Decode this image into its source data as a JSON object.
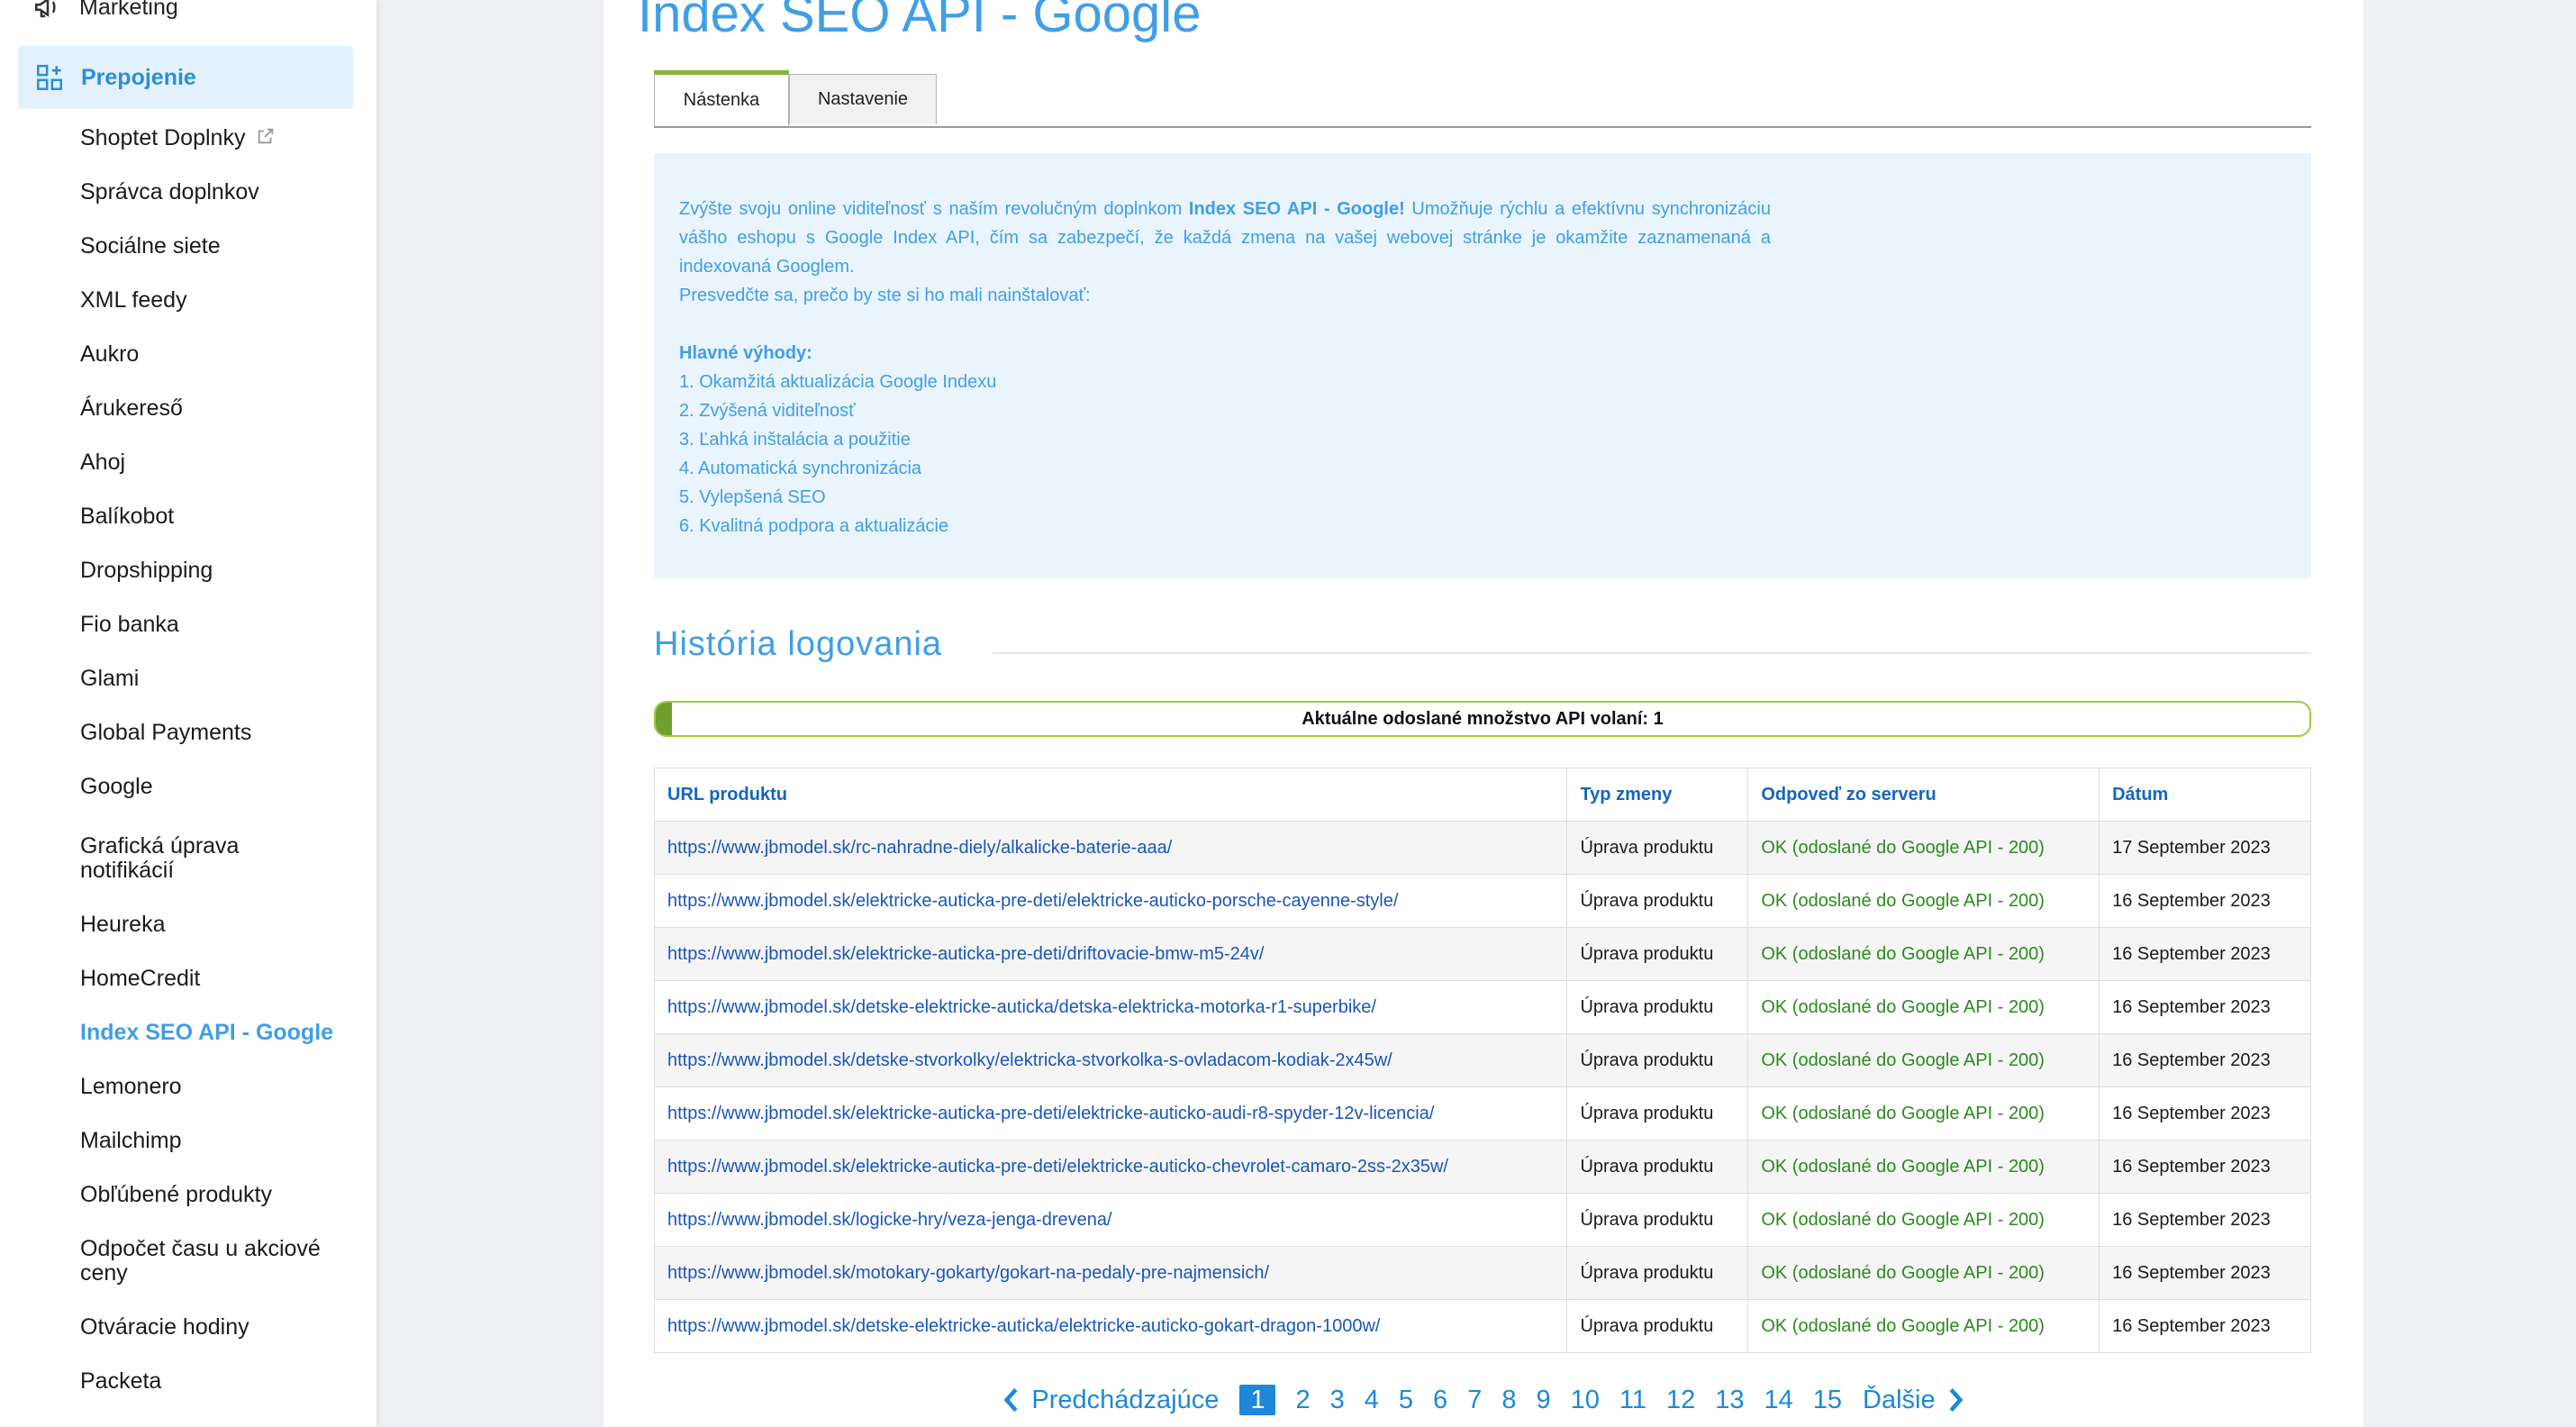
{
  "sidebar": {
    "top_item": "Marketing",
    "active_section": "Prepojenie",
    "items": [
      {
        "label": "Shoptet Doplnky",
        "external": true
      },
      {
        "label": "Správca doplnkov"
      },
      {
        "label": "Sociálne siete"
      },
      {
        "label": "XML feedy"
      },
      {
        "label": "Aukro"
      },
      {
        "label": "Árukereső"
      },
      {
        "label": "Ahoj"
      },
      {
        "label": "Balíkobot"
      },
      {
        "label": "Dropshipping"
      },
      {
        "label": "Fio banka"
      },
      {
        "label": "Glami"
      },
      {
        "label": "Global Payments"
      },
      {
        "label": "Google"
      },
      {
        "label": "Grafická úprava notifikácií"
      },
      {
        "label": "Heureka"
      },
      {
        "label": "HomeCredit"
      },
      {
        "label": "Index SEO API - Google",
        "current": true
      },
      {
        "label": "Lemonero"
      },
      {
        "label": "Mailchimp"
      },
      {
        "label": "Obľúbené produkty"
      },
      {
        "label": "Odpočet času u akciové ceny"
      },
      {
        "label": "Otváracie hodiny"
      },
      {
        "label": "Packeta"
      }
    ]
  },
  "main": {
    "title": "Index SEO API - Google",
    "tabs": [
      {
        "label": "Nástenka",
        "active": true
      },
      {
        "label": "Nastavenie",
        "active": false
      }
    ],
    "intro": {
      "p1_before": "Zvýšte svoju online viditeľnosť s naším revolučným doplnkom ",
      "p1_bold": "Index SEO API - Google!",
      "p1_after": " Umožňuje rýchlu a efektívnu synchronizáciu vášho eshopu s Google Index API, čím sa zabezpečí, že každá zmena na vašej webovej stránke je okamžite zaznamenaná a indexovaná Googlem.",
      "p2": "Presvedčte sa, prečo by ste si ho mali nainštalovať:",
      "benefits_title": "Hlavné výhody:",
      "benefits": [
        "1. Okamžitá aktualizácia Google Indexu",
        "2. Zvýšená viditeľnosť",
        "3. Ľahká inštalácia a použitie",
        "4. Automatická synchronizácia",
        "5. Vylepšená SEO",
        "6. Kvalitná podpora a aktualizácie"
      ]
    },
    "log_title": "História logovania",
    "api_counter": {
      "label": "Aktuálne odoslané množstvo API volaní: 1",
      "fill_percent": 1
    },
    "table": {
      "headers": [
        "URL produktu",
        "Typ zmeny",
        "Odpoveď zo serveru",
        "Dátum"
      ],
      "rows": [
        {
          "url": "https://www.jbmodel.sk/rc-nahradne-diely/alkalicke-baterie-aaa/",
          "type": "Úprava produktu",
          "response": "OK (odoslané do Google API - 200)",
          "date": "17 September 2023"
        },
        {
          "url": "https://www.jbmodel.sk/elektricke-auticka-pre-deti/elektricke-auticko-porsche-cayenne-style/",
          "type": "Úprava produktu",
          "response": "OK (odoslané do Google API - 200)",
          "date": "16 September 2023"
        },
        {
          "url": "https://www.jbmodel.sk/elektricke-auticka-pre-deti/driftovacie-bmw-m5-24v/",
          "type": "Úprava produktu",
          "response": "OK (odoslané do Google API - 200)",
          "date": "16 September 2023"
        },
        {
          "url": "https://www.jbmodel.sk/detske-elektricke-auticka/detska-elektricka-motorka-r1-superbike/",
          "type": "Úprava produktu",
          "response": "OK (odoslané do Google API - 200)",
          "date": "16 September 2023"
        },
        {
          "url": "https://www.jbmodel.sk/detske-stvorkolky/elektricka-stvorkolka-s-ovladacom-kodiak-2x45w/",
          "type": "Úprava produktu",
          "response": "OK (odoslané do Google API - 200)",
          "date": "16 September 2023"
        },
        {
          "url": "https://www.jbmodel.sk/elektricke-auticka-pre-deti/elektricke-auticko-audi-r8-spyder-12v-licencia/",
          "type": "Úprava produktu",
          "response": "OK (odoslané do Google API - 200)",
          "date": "16 September 2023"
        },
        {
          "url": "https://www.jbmodel.sk/elektricke-auticka-pre-deti/elektricke-auticko-chevrolet-camaro-2ss-2x35w/",
          "type": "Úprava produktu",
          "response": "OK (odoslané do Google API - 200)",
          "date": "16 September 2023"
        },
        {
          "url": "https://www.jbmodel.sk/logicke-hry/veza-jenga-drevena/",
          "type": "Úprava produktu",
          "response": "OK (odoslané do Google API - 200)",
          "date": "16 September 2023"
        },
        {
          "url": "https://www.jbmodel.sk/motokary-gokarty/gokart-na-pedaly-pre-najmensich/",
          "type": "Úprava produktu",
          "response": "OK (odoslané do Google API - 200)",
          "date": "16 September 2023"
        },
        {
          "url": "https://www.jbmodel.sk/detske-elektricke-auticka/elektricke-auticko-gokart-dragon-1000w/",
          "type": "Úprava produktu",
          "response": "OK (odoslané do Google API - 200)",
          "date": "16 September 2023"
        }
      ]
    },
    "pagination": {
      "prev": "Predchádzajúce",
      "next": "Ďalšie",
      "pages": [
        "1",
        "2",
        "3",
        "4",
        "5",
        "6",
        "7",
        "8",
        "9",
        "10",
        "11",
        "12",
        "13",
        "14",
        "15"
      ],
      "current": "1"
    }
  },
  "colors": {
    "accent": "#3f9fe6",
    "link": "#1a56b8",
    "success": "#2a8a1e",
    "tab_active_border": "#86b33b",
    "progress_border": "#9ccc3c",
    "active_bg": "#e3f1fc"
  },
  "icons": {
    "marketing": "megaphone-icon",
    "prepojenie": "widgets-plus-icon",
    "external": "external-link-icon",
    "prev": "chevron-left-icon",
    "next": "chevron-right-icon"
  }
}
